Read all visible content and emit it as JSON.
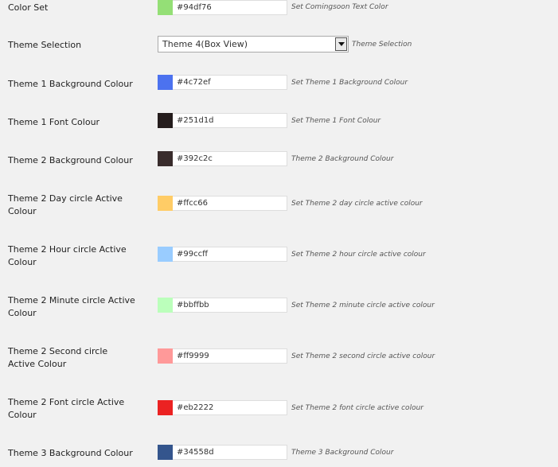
{
  "rows": [
    {
      "type": "color",
      "label": "Color Set",
      "value": "#94df76",
      "swatch": "#94df76",
      "desc": "Set Comingsoon Text Color"
    },
    {
      "type": "select",
      "label": "Theme Selection",
      "value": "Theme 4(Box View)",
      "desc": "Theme Selection"
    },
    {
      "type": "color",
      "label": "Theme 1 Background Colour",
      "value": "#4c72ef",
      "swatch": "#4c72ef",
      "desc": "Set Theme 1 Background Colour"
    },
    {
      "type": "color",
      "label": "Theme 1 Font Colour",
      "value": "#251d1d",
      "swatch": "#251d1d",
      "desc": "Set Theme 1 Font Colour"
    },
    {
      "type": "color",
      "label": "Theme 2 Background Colour",
      "value": "#392c2c",
      "swatch": "#392c2c",
      "desc": "Theme 2 Background Colour"
    },
    {
      "type": "color",
      "label": "Theme 2 Day circle Active Colour",
      "value": "#ffcc66",
      "swatch": "#ffcc66",
      "desc": "Set Theme 2 day circle active colour"
    },
    {
      "type": "color",
      "label": "Theme 2 Hour circle Active Colour",
      "value": "#99ccff",
      "swatch": "#99ccff",
      "desc": "Set Theme 2 hour circle active colour"
    },
    {
      "type": "color",
      "label": "Theme 2 Minute circle Active Colour",
      "value": "#bbffbb",
      "swatch": "#bbffbb",
      "desc": "Set Theme 2 minute circle active colour"
    },
    {
      "type": "color",
      "label": "Theme 2 Second circle Active Colour",
      "value": "#ff9999",
      "swatch": "#ff9999",
      "desc": "Set Theme 2 second circle active colour"
    },
    {
      "type": "color",
      "label": "Theme 2 Font circle Active Colour",
      "value": "#eb2222",
      "swatch": "#eb2222",
      "desc": "Set Theme 2 font circle active colour"
    },
    {
      "type": "color",
      "label": "Theme 3 Background Colour",
      "value": "#34558d",
      "swatch": "#34558d",
      "desc": "Theme 3 Background Colour"
    }
  ]
}
